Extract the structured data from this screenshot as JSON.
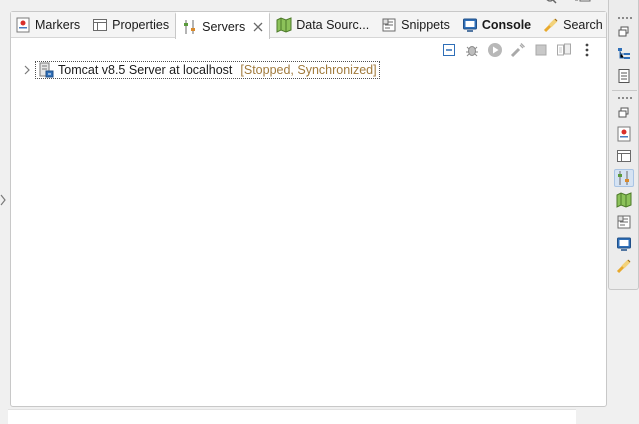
{
  "tabs": [
    {
      "label": "Markers",
      "icon": "markers-icon"
    },
    {
      "label": "Properties",
      "icon": "properties-icon"
    },
    {
      "label": "Servers",
      "icon": "servers-icon",
      "active": true
    },
    {
      "label": "Data Sourc...",
      "icon": "data-source-icon"
    },
    {
      "label": "Snippets",
      "icon": "snippets-icon"
    },
    {
      "label": "Console",
      "icon": "console-icon",
      "bold": true
    },
    {
      "label": "Search",
      "icon": "search-icon"
    }
  ],
  "servers": {
    "items": [
      {
        "name": "Tomcat v8.5 Server at localhost",
        "status": "[Stopped, Synchronized]"
      }
    ]
  },
  "toolbar": {
    "buttons": [
      "collapse-all",
      "debug",
      "start",
      "profile",
      "stop",
      "publish",
      "view-menu"
    ]
  },
  "trim": {
    "top_group": [
      "restore",
      "outline",
      "task-list"
    ],
    "bottom_group": [
      "restore",
      "markers",
      "properties",
      "servers",
      "data-source",
      "snippets",
      "console",
      "search"
    ]
  },
  "colors": {
    "accent": "#2f6fb8",
    "status_text": "#a07a3c",
    "panel_bg": "#ffffff",
    "frame_bg": "#f0f0f0"
  }
}
